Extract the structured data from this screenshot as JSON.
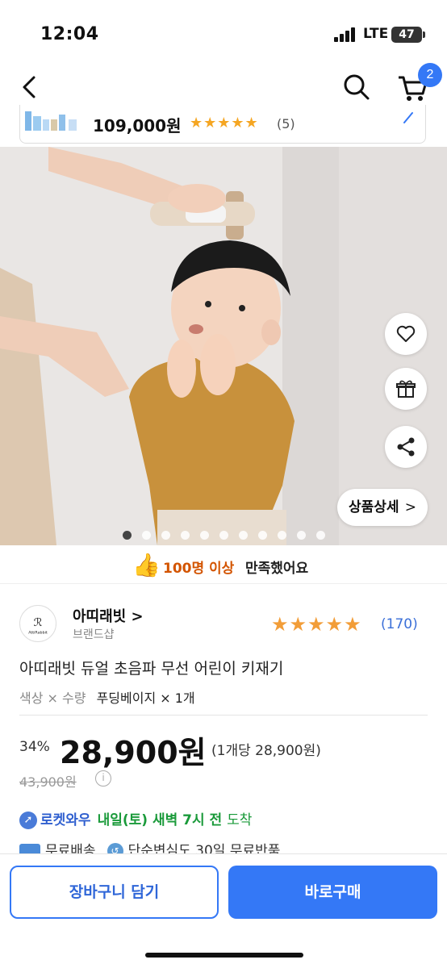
{
  "status_bar": {
    "time": "12:04",
    "network": "LTE",
    "battery": "47"
  },
  "nav": {
    "cart_count": "2"
  },
  "mini_bar": {
    "price": "109,000원",
    "stars": "★★★★★",
    "review_count": "(5)"
  },
  "gallery": {
    "detail_label": "상품상세",
    "detail_chevron": ">",
    "total_images": 11,
    "current_index": 0
  },
  "satisfaction": {
    "icon": "👍",
    "highlight": "100명 이상",
    "text": "만족했어요"
  },
  "brand": {
    "name": "아띠래빗 >",
    "shop_label": "브랜드샵",
    "rating_stars": "★★★★★",
    "rating_count": "(170)"
  },
  "product": {
    "title": "아띠래빗 듀얼 초음파 무선 어린이 키재기",
    "option_label": "색상 × 수량",
    "option_value": "푸딩베이지 × 1개"
  },
  "pricing": {
    "discount": "34%",
    "price": "28,900원",
    "unit_price": "(1개당 28,900원)",
    "original_price": "43,900원",
    "info_icon": "i"
  },
  "delivery": {
    "rocket_brand": "로켓와우",
    "when": "내일(토) 새벽 7시 전",
    "arrive": "도착",
    "free_shipping": "무료배송",
    "return_policy": "단순변심도 30일 무료반품"
  },
  "actions": {
    "cart_label": "장바구니 담기",
    "buy_label": "바로구매"
  },
  "colors": {
    "accent": "#3478f6",
    "star": "#f5a623",
    "rocket_green": "#1a9a3a"
  }
}
